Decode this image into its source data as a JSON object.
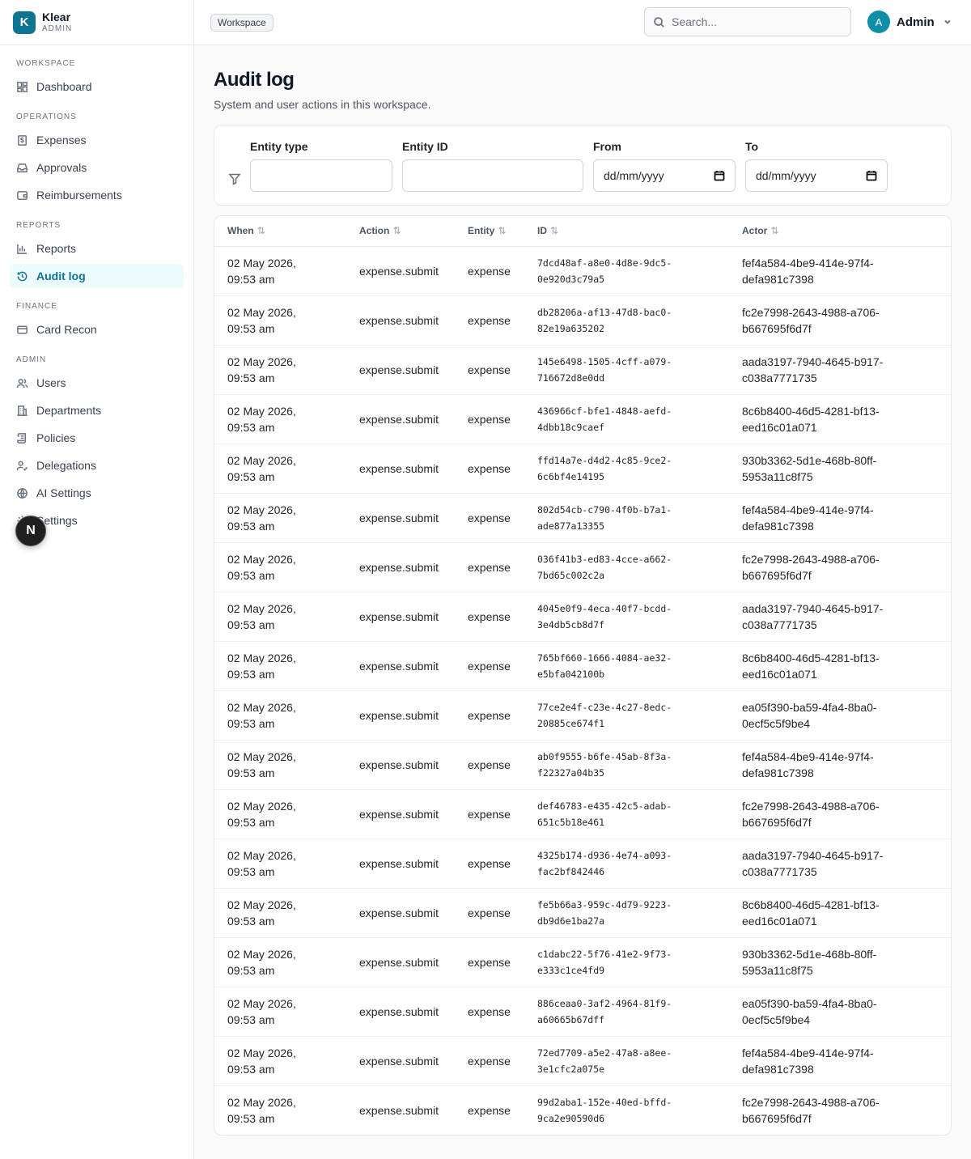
{
  "brand": {
    "logo_letter": "K",
    "name": "Klear",
    "subtitle": "ADMIN"
  },
  "sidebar": {
    "sections": [
      {
        "label": "WORKSPACE",
        "items": [
          {
            "label": "Dashboard",
            "icon": "dashboard-icon"
          }
        ]
      },
      {
        "label": "OPERATIONS",
        "items": [
          {
            "label": "Expenses",
            "icon": "receipt-icon"
          },
          {
            "label": "Approvals",
            "icon": "inbox-icon"
          },
          {
            "label": "Reimbursements",
            "icon": "wallet-icon"
          }
        ]
      },
      {
        "label": "REPORTS",
        "items": [
          {
            "label": "Reports",
            "icon": "bar-chart-icon"
          },
          {
            "label": "Audit log",
            "icon": "history-icon",
            "active": true
          }
        ]
      },
      {
        "label": "FINANCE",
        "items": [
          {
            "label": "Card Recon",
            "icon": "credit-card-icon"
          }
        ]
      },
      {
        "label": "ADMIN",
        "items": [
          {
            "label": "Users",
            "icon": "users-icon"
          },
          {
            "label": "Departments",
            "icon": "building-icon"
          },
          {
            "label": "Policies",
            "icon": "scroll-icon"
          },
          {
            "label": "Delegations",
            "icon": "user-check-icon"
          },
          {
            "label": "AI Settings",
            "icon": "globe-icon"
          },
          {
            "label": "Settings",
            "icon": "gear-icon"
          }
        ]
      }
    ]
  },
  "floating_badge": "N",
  "topbar": {
    "workspace_badge": "Workspace",
    "search_placeholder": "Search...",
    "user_initial": "A",
    "user_name": "Admin"
  },
  "page": {
    "title": "Audit log",
    "subtitle": "System and user actions in this workspace."
  },
  "filters": {
    "entity_type_label": "Entity type",
    "entity_id_label": "Entity ID",
    "from_label": "From",
    "to_label": "To",
    "date_placeholder": "dd/mm/yyyy"
  },
  "table": {
    "columns": [
      "When",
      "Action",
      "Entity",
      "ID",
      "Actor"
    ],
    "sort_glyph": "⇅",
    "rows": [
      {
        "when_date": "02 May 2026,",
        "when_time": "09:53 am",
        "action": "expense.submit",
        "entity": "expense",
        "id_a": "7dcd48af-a8e0-4d8e-9dc5-",
        "id_b": "0e920d3c79a5",
        "actor_a": "fef4a584-4be9-414e-97f4-",
        "actor_b": "defa981c7398"
      },
      {
        "when_date": "02 May 2026,",
        "when_time": "09:53 am",
        "action": "expense.submit",
        "entity": "expense",
        "id_a": "db28206a-af13-47d8-bac0-",
        "id_b": "82e19a635202",
        "actor_a": "fc2e7998-2643-4988-a706-",
        "actor_b": "b667695f6d7f"
      },
      {
        "when_date": "02 May 2026,",
        "when_time": "09:53 am",
        "action": "expense.submit",
        "entity": "expense",
        "id_a": "145e6498-1505-4cff-a079-",
        "id_b": "716672d8e0dd",
        "actor_a": "aada3197-7940-4645-b917-",
        "actor_b": "c038a7771735"
      },
      {
        "when_date": "02 May 2026,",
        "when_time": "09:53 am",
        "action": "expense.submit",
        "entity": "expense",
        "id_a": "436966cf-bfe1-4848-aefd-",
        "id_b": "4dbb18c9caef",
        "actor_a": "8c6b8400-46d5-4281-bf13-",
        "actor_b": "eed16c01a071"
      },
      {
        "when_date": "02 May 2026,",
        "when_time": "09:53 am",
        "action": "expense.submit",
        "entity": "expense",
        "id_a": "ffd14a7e-d4d2-4c85-9ce2-",
        "id_b": "6c6bf4e14195",
        "actor_a": "930b3362-5d1e-468b-80ff-",
        "actor_b": "5953a11c8f75"
      },
      {
        "when_date": "02 May 2026,",
        "when_time": "09:53 am",
        "action": "expense.submit",
        "entity": "expense",
        "id_a": "802d54cb-c790-4f0b-b7a1-",
        "id_b": "ade877a13355",
        "actor_a": "fef4a584-4be9-414e-97f4-",
        "actor_b": "defa981c7398"
      },
      {
        "when_date": "02 May 2026,",
        "when_time": "09:53 am",
        "action": "expense.submit",
        "entity": "expense",
        "id_a": "036f41b3-ed83-4cce-a662-",
        "id_b": "7bd65c002c2a",
        "actor_a": "fc2e7998-2643-4988-a706-",
        "actor_b": "b667695f6d7f"
      },
      {
        "when_date": "02 May 2026,",
        "when_time": "09:53 am",
        "action": "expense.submit",
        "entity": "expense",
        "id_a": "4045e0f9-4eca-40f7-bcdd-",
        "id_b": "3e4db5cb8d7f",
        "actor_a": "aada3197-7940-4645-b917-",
        "actor_b": "c038a7771735"
      },
      {
        "when_date": "02 May 2026,",
        "when_time": "09:53 am",
        "action": "expense.submit",
        "entity": "expense",
        "id_a": "765bf660-1666-4084-ae32-",
        "id_b": "e5bfa042100b",
        "actor_a": "8c6b8400-46d5-4281-bf13-",
        "actor_b": "eed16c01a071"
      },
      {
        "when_date": "02 May 2026,",
        "when_time": "09:53 am",
        "action": "expense.submit",
        "entity": "expense",
        "id_a": "77ce2e4f-c23e-4c27-8edc-",
        "id_b": "20885ce674f1",
        "actor_a": "ea05f390-ba59-4fa4-8ba0-",
        "actor_b": "0ecf5c5f9be4"
      },
      {
        "when_date": "02 May 2026,",
        "when_time": "09:53 am",
        "action": "expense.submit",
        "entity": "expense",
        "id_a": "ab0f9555-b6fe-45ab-8f3a-",
        "id_b": "f22327a04b35",
        "actor_a": "fef4a584-4be9-414e-97f4-",
        "actor_b": "defa981c7398"
      },
      {
        "when_date": "02 May 2026,",
        "when_time": "09:53 am",
        "action": "expense.submit",
        "entity": "expense",
        "id_a": "def46783-e435-42c5-adab-",
        "id_b": "651c5b18e461",
        "actor_a": "fc2e7998-2643-4988-a706-",
        "actor_b": "b667695f6d7f"
      },
      {
        "when_date": "02 May 2026,",
        "when_time": "09:53 am",
        "action": "expense.submit",
        "entity": "expense",
        "id_a": "4325b174-d936-4e74-a093-",
        "id_b": "fac2bf842446",
        "actor_a": "aada3197-7940-4645-b917-",
        "actor_b": "c038a7771735"
      },
      {
        "when_date": "02 May 2026,",
        "when_time": "09:53 am",
        "action": "expense.submit",
        "entity": "expense",
        "id_a": "fe5b66a3-959c-4d79-9223-",
        "id_b": "db9d6e1ba27a",
        "actor_a": "8c6b8400-46d5-4281-bf13-",
        "actor_b": "eed16c01a071"
      },
      {
        "when_date": "02 May 2026,",
        "when_time": "09:53 am",
        "action": "expense.submit",
        "entity": "expense",
        "id_a": "c1dabc22-5f76-41e2-9f73-",
        "id_b": "e333c1ce4fd9",
        "actor_a": "930b3362-5d1e-468b-80ff-",
        "actor_b": "5953a11c8f75"
      },
      {
        "when_date": "02 May 2026,",
        "when_time": "09:53 am",
        "action": "expense.submit",
        "entity": "expense",
        "id_a": "886ceaa0-3af2-4964-81f9-",
        "id_b": "a60665b67dff",
        "actor_a": "ea05f390-ba59-4fa4-8ba0-",
        "actor_b": "0ecf5c5f9be4"
      },
      {
        "when_date": "02 May 2026,",
        "when_time": "09:53 am",
        "action": "expense.submit",
        "entity": "expense",
        "id_a": "72ed7709-a5e2-47a8-a8ee-",
        "id_b": "3e1cfc2a075e",
        "actor_a": "fef4a584-4be9-414e-97f4-",
        "actor_b": "defa981c7398"
      },
      {
        "when_date": "02 May 2026,",
        "when_time": "09:53 am",
        "action": "expense.submit",
        "entity": "expense",
        "id_a": "99d2aba1-152e-40ed-bffd-",
        "id_b": "9ca2e90590d6",
        "actor_a": "fc2e7998-2643-4988-a706-",
        "actor_b": "b667695f6d7f"
      }
    ]
  }
}
